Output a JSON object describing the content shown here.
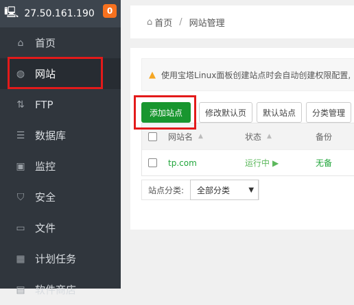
{
  "sidebar": {
    "ip": "27.50.161.190",
    "badge": "0",
    "items": [
      {
        "label": "首页",
        "icon": "home-icon"
      },
      {
        "label": "网站",
        "icon": "globe-icon"
      },
      {
        "label": "FTP",
        "icon": "ftp-icon"
      },
      {
        "label": "数据库",
        "icon": "database-icon"
      },
      {
        "label": "监控",
        "icon": "monitor-icon"
      },
      {
        "label": "安全",
        "icon": "shield-icon"
      },
      {
        "label": "文件",
        "icon": "folder-icon"
      },
      {
        "label": "计划任务",
        "icon": "calendar-icon"
      },
      {
        "label": "软件商店",
        "icon": "store-icon"
      }
    ]
  },
  "breadcrumb": {
    "home": "首页",
    "sep": "/",
    "current": "网站管理"
  },
  "alert": "使用宝塔Linux面板创建站点时会自动创建权限配置,",
  "toolbar": {
    "add": "添加站点",
    "modify_default": "修改默认页",
    "default_site": "默认站点",
    "category": "分类管理"
  },
  "table": {
    "headers": {
      "name": "网站名",
      "status": "状态",
      "backup": "备份"
    },
    "rows": [
      {
        "name": "tp.com",
        "status": "运行中",
        "backup": "无备"
      }
    ]
  },
  "filter": {
    "label": "站点分类:",
    "value": "全部分类"
  },
  "colors": {
    "accent": "#18962f",
    "highlight": "#e31a1a"
  }
}
